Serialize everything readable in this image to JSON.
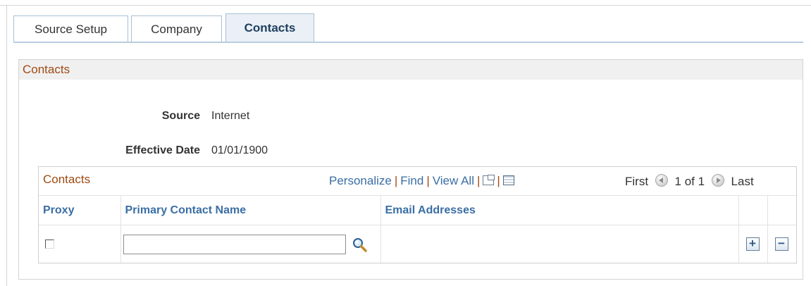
{
  "tabs": [
    {
      "label": "Source Setup",
      "active": false
    },
    {
      "label": "Company",
      "active": false
    },
    {
      "label": "Contacts",
      "active": true
    }
  ],
  "section": {
    "title": "Contacts",
    "fields": {
      "source_label": "Source",
      "source_value": "Internet",
      "effective_date_label": "Effective Date",
      "effective_date_value": "01/01/1900"
    }
  },
  "grid": {
    "title": "Contacts",
    "nav": {
      "personalize": "Personalize",
      "find": "Find",
      "view_all": "View All",
      "separator": "|",
      "zoom_icon": "zoom-grid-icon",
      "download_icon": "download-to-excel-icon"
    },
    "pager": {
      "first": "First",
      "range": "1 of 1",
      "last": "Last"
    },
    "columns": {
      "proxy": "Proxy",
      "primary_contact_name": "Primary Contact Name",
      "email_addresses": "Email Addresses"
    },
    "rows": [
      {
        "proxy_checked": false,
        "primary_contact_name": "",
        "email_addresses": ""
      }
    ],
    "row_actions": {
      "add": "+",
      "delete": "−"
    }
  },
  "colors": {
    "section_title": "#a04a14",
    "link": "#3a6ea5",
    "active_tab_bg": "#eaf0f6"
  }
}
